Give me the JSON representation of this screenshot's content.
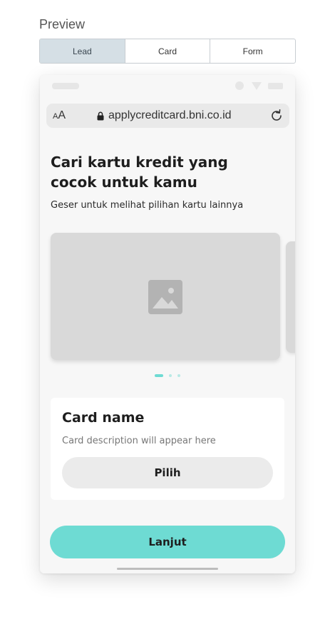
{
  "header": {
    "title": "Preview"
  },
  "tabs": [
    {
      "label": "Lead",
      "active": true
    },
    {
      "label": "Card",
      "active": false
    },
    {
      "label": "Form",
      "active": false
    }
  ],
  "browser": {
    "text_size_icon": "AA",
    "url": "applycreditcard.bni.co.id",
    "icons": [
      "lock-icon",
      "reload-icon"
    ]
  },
  "content": {
    "headline": "Cari kartu kredit yang cocok untuk kamu",
    "subline": "Geser untuk melihat pilihan kartu lainnya",
    "carousel": {
      "slide_count": 3,
      "active_index": 0,
      "image_icon": "image-placeholder-icon"
    },
    "card": {
      "name": "Card name",
      "description": "Card description will appear here",
      "select_label": "Pilih"
    },
    "next_label": "Lanjut"
  },
  "colors": {
    "accent": "#6edbd3",
    "accent_light": "#b8e9e5",
    "tab_active_bg": "#d5dfe5",
    "placeholder_gray": "#d9d9d9",
    "phone_bg": "#f7f7f7"
  }
}
